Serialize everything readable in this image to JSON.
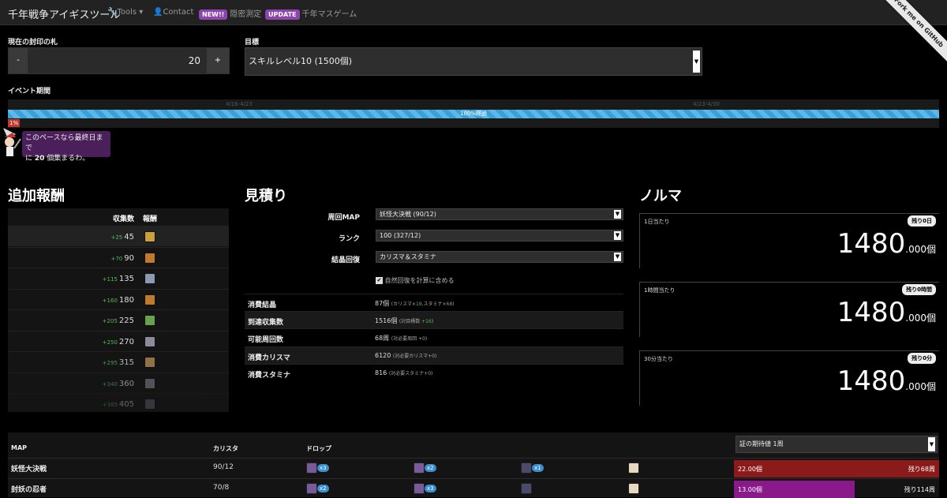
{
  "nav": {
    "brand": "千年戦争アイギスツール",
    "tools": "Tools",
    "contact": "Contact",
    "badge_new": "NEW!!",
    "hidden_stats": "隠密測定",
    "badge_update": "UPDATE",
    "millennium_game": "千年マスゲーム",
    "fork_ribbon": "Fork me on GitHub"
  },
  "seal": {
    "label": "現在の封印の札",
    "minus": "-",
    "value": "20",
    "plus": "+"
  },
  "goal": {
    "label": "目標",
    "selected": "スキルレベル10 (1500個)"
  },
  "event": {
    "label": "イベント期間",
    "week1": "4/16-4/23",
    "week2": "4/23-4/30",
    "progress_text": "100%経過",
    "progress_value": 1.0,
    "pct_badge": "1%",
    "message_line1": "このペースなら最終日まで",
    "message_pre": "に ",
    "message_count": "20",
    "message_post": " 個集まるわ。"
  },
  "rewards": {
    "title": "追加報酬",
    "col_count": "収集数",
    "col_reward": "報酬",
    "rows": [
      {
        "plus": "+25",
        "count": "45",
        "color": "#c9a040"
      },
      {
        "plus": "+70",
        "count": "90",
        "color": "#c07a30"
      },
      {
        "plus": "+115",
        "count": "135",
        "color": "#8a9ab0"
      },
      {
        "plus": "+160",
        "count": "180",
        "color": "#c07a30"
      },
      {
        "plus": "+205",
        "count": "225",
        "color": "#6aa050"
      },
      {
        "plus": "+250",
        "count": "270",
        "color": "#8a8a9a"
      },
      {
        "plus": "+295",
        "count": "315",
        "color": "#b08a50"
      },
      {
        "plus": "+340",
        "count": "360",
        "color": "#7a7a8a"
      },
      {
        "plus": "+385",
        "count": "405",
        "color": "#6a6a7a"
      }
    ]
  },
  "estimate": {
    "title": "見積り",
    "map_label": "周回MAP",
    "map_value": "妖怪大決戦 (90/12)",
    "rank_label": "ランク",
    "rank_value": "100 (327/12)",
    "recovery_label": "結晶回復",
    "recovery_value": "カリスマ＆スタミナ",
    "natural_recovery": "自然回復を計算に含める",
    "rows": [
      {
        "key": "消費結晶",
        "value": "87個",
        "note_pre": "(カリスマ×",
        "note_a": "19",
        "note_mid": ",スタミナ×",
        "note_b": "68",
        "note_post": ")"
      },
      {
        "key": "到達収集数",
        "value": "1516個",
        "note_pre": "(対目標数 ",
        "note_a": "+16",
        "note_mid": "",
        "note_b": "",
        "note_post": ")"
      },
      {
        "key": "可能周回数",
        "value": "68周",
        "note_pre": "(対必要周回 +0)",
        "note_a": "",
        "note_mid": "",
        "note_b": "",
        "note_post": ""
      },
      {
        "key": "消費カリスマ",
        "value": "6120",
        "note_pre": "(対必要カリスマ+0)",
        "note_a": "",
        "note_mid": "",
        "note_b": "",
        "note_post": ""
      },
      {
        "key": "消費スタミナ",
        "value": "816",
        "note_pre": "(対必要スタミナ+0)",
        "note_a": "",
        "note_mid": "",
        "note_b": "",
        "note_post": ""
      }
    ]
  },
  "quota": {
    "title": "ノルマ",
    "cards": [
      {
        "title": "1日当たり",
        "remain": "残り0日",
        "value": "1480",
        "decimal": ".000",
        "unit": "個"
      },
      {
        "title": "1時間当たり",
        "remain": "残り0時間",
        "value": "1480",
        "decimal": ".000",
        "unit": "個"
      },
      {
        "title": "30分当たり",
        "remain": "残り0分",
        "value": "1480",
        "decimal": ".000",
        "unit": "個"
      }
    ]
  },
  "map_table": {
    "col_map": "MAP",
    "col_charisma": "カリスタ",
    "col_drop": "ドロップ",
    "expect_select": "証の期待値 1周",
    "rows": [
      {
        "name": "妖怪大決戦",
        "charisma": "90/12",
        "drops": [
          "x3",
          "x2",
          "x1",
          ""
        ],
        "expect": "22.00個",
        "remain": "残り68周",
        "fill": 1.0,
        "color": "#8b1a1a"
      },
      {
        "name": "封妖の忍者",
        "charisma": "70/8",
        "drops": [
          "x2",
          "x3",
          "",
          ""
        ],
        "expect": "13.00個",
        "remain": "残り114周",
        "fill": 0.59,
        "color": "#8a1a8a"
      }
    ]
  }
}
